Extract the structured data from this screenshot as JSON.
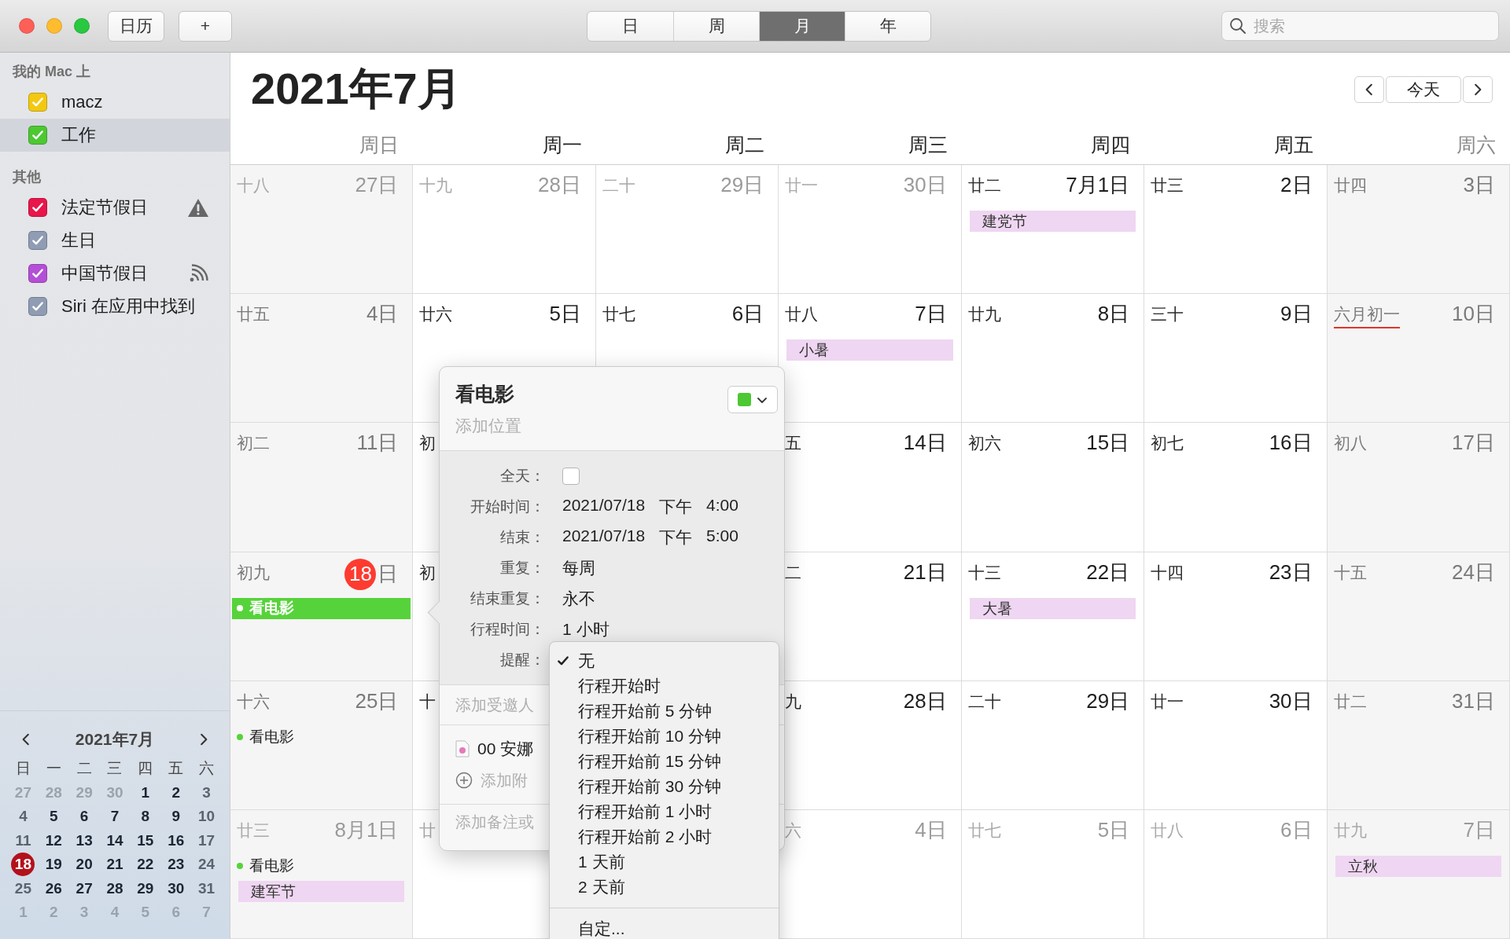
{
  "toolbar": {
    "calendars_button": "日历",
    "add_button": "+",
    "view_tabs": [
      {
        "label": "日",
        "selected": false
      },
      {
        "label": "周",
        "selected": false
      },
      {
        "label": "月",
        "selected": true
      },
      {
        "label": "年",
        "selected": false
      }
    ],
    "search": {
      "placeholder": "搜索"
    }
  },
  "sidebar": {
    "sections": [
      {
        "title": "我的 Mac 上",
        "items": [
          {
            "name": "macz",
            "color": "#f2c811",
            "checked": true,
            "selected": false,
            "kind": "plain"
          },
          {
            "name": "工作",
            "color": "#4cc832",
            "checked": true,
            "selected": true,
            "kind": "plain"
          }
        ]
      },
      {
        "title": "其他",
        "items": [
          {
            "name": "法定节假日",
            "color": "#e8164a",
            "checked": true,
            "selected": false,
            "kind": "warning"
          },
          {
            "name": "生日",
            "color": "#8f9cb3",
            "checked": true,
            "selected": false,
            "kind": "plain"
          },
          {
            "name": "中国节假日",
            "color": "#b44fd6",
            "checked": true,
            "selected": false,
            "kind": "subscribed"
          },
          {
            "name": "Siri 在应用中找到",
            "color": "#8f9cb3",
            "checked": true,
            "selected": false,
            "kind": "plain"
          }
        ]
      }
    ]
  },
  "mini_calendar": {
    "title": "2021年7月",
    "weekdays": [
      "日",
      "一",
      "二",
      "三",
      "四",
      "五",
      "六"
    ],
    "days": [
      {
        "day": "27",
        "other_month": true,
        "today": false
      },
      {
        "day": "28",
        "other_month": true,
        "today": false
      },
      {
        "day": "29",
        "other_month": true,
        "today": false
      },
      {
        "day": "30",
        "other_month": true,
        "today": false
      },
      {
        "day": "1",
        "other_month": false,
        "today": false
      },
      {
        "day": "2",
        "other_month": false,
        "today": false
      },
      {
        "day": "3",
        "other_month": false,
        "today": false
      },
      {
        "day": "4",
        "other_month": false,
        "today": false
      },
      {
        "day": "5",
        "other_month": false,
        "today": false
      },
      {
        "day": "6",
        "other_month": false,
        "today": false
      },
      {
        "day": "7",
        "other_month": false,
        "today": false
      },
      {
        "day": "8",
        "other_month": false,
        "today": false
      },
      {
        "day": "9",
        "other_month": false,
        "today": false
      },
      {
        "day": "10",
        "other_month": false,
        "today": false
      },
      {
        "day": "11",
        "other_month": false,
        "today": false
      },
      {
        "day": "12",
        "other_month": false,
        "today": false
      },
      {
        "day": "13",
        "other_month": false,
        "today": false
      },
      {
        "day": "14",
        "other_month": false,
        "today": false
      },
      {
        "day": "15",
        "other_month": false,
        "today": false
      },
      {
        "day": "16",
        "other_month": false,
        "today": false
      },
      {
        "day": "17",
        "other_month": false,
        "today": false
      },
      {
        "day": "18",
        "other_month": false,
        "today": true
      },
      {
        "day": "19",
        "other_month": false,
        "today": false
      },
      {
        "day": "20",
        "other_month": false,
        "today": false
      },
      {
        "day": "21",
        "other_month": false,
        "today": false
      },
      {
        "day": "22",
        "other_month": false,
        "today": false
      },
      {
        "day": "23",
        "other_month": false,
        "today": false
      },
      {
        "day": "24",
        "other_month": false,
        "today": false
      },
      {
        "day": "25",
        "other_month": false,
        "today": false
      },
      {
        "day": "26",
        "other_month": false,
        "today": false
      },
      {
        "day": "27",
        "other_month": false,
        "today": false
      },
      {
        "day": "28",
        "other_month": false,
        "today": false
      },
      {
        "day": "29",
        "other_month": false,
        "today": false
      },
      {
        "day": "30",
        "other_month": false,
        "today": false
      },
      {
        "day": "31",
        "other_month": false,
        "today": false
      },
      {
        "day": "1",
        "other_month": true,
        "today": false
      },
      {
        "day": "2",
        "other_month": true,
        "today": false
      },
      {
        "day": "3",
        "other_month": true,
        "today": false
      },
      {
        "day": "4",
        "other_month": true,
        "today": false
      },
      {
        "day": "5",
        "other_month": true,
        "today": false
      },
      {
        "day": "6",
        "other_month": true,
        "today": false
      },
      {
        "day": "7",
        "other_month": true,
        "today": false
      }
    ]
  },
  "header": {
    "title": "2021年7月",
    "today_button": "今天"
  },
  "weekdays": [
    "周日",
    "周一",
    "周二",
    "周三",
    "周四",
    "周五",
    "周六"
  ],
  "cells": [
    {
      "lunar": "十八",
      "date": "27日",
      "other_month": true,
      "today": false,
      "lunar_month_start": false
    },
    {
      "lunar": "十九",
      "date": "28日",
      "other_month": true,
      "today": false,
      "lunar_month_start": false
    },
    {
      "lunar": "二十",
      "date": "29日",
      "other_month": true,
      "today": false,
      "lunar_month_start": false
    },
    {
      "lunar": "廿一",
      "date": "30日",
      "other_month": true,
      "today": false,
      "lunar_month_start": false
    },
    {
      "lunar": "廿二",
      "date": "7月1日",
      "other_month": false,
      "today": false,
      "lunar_month_start": false,
      "events": [
        {
          "title": "建党节",
          "kind": "allday",
          "color": "#efd6f2",
          "selected": false
        }
      ]
    },
    {
      "lunar": "廿三",
      "date": "2日",
      "other_month": false,
      "today": false,
      "lunar_month_start": false
    },
    {
      "lunar": "廿四",
      "date": "3日",
      "other_month": false,
      "today": false,
      "lunar_month_start": false
    },
    {
      "lunar": "廿五",
      "date": "4日",
      "other_month": false,
      "today": false,
      "lunar_month_start": false
    },
    {
      "lunar": "廿六",
      "date": "5日",
      "other_month": false,
      "today": false,
      "lunar_month_start": false
    },
    {
      "lunar": "廿七",
      "date": "6日",
      "other_month": false,
      "today": false,
      "lunar_month_start": false
    },
    {
      "lunar": "廿八",
      "date": "7日",
      "other_month": false,
      "today": false,
      "lunar_month_start": false,
      "events": [
        {
          "title": "小暑",
          "kind": "allday",
          "color": "#efd6f2",
          "selected": false
        }
      ]
    },
    {
      "lunar": "廿九",
      "date": "8日",
      "other_month": false,
      "today": false,
      "lunar_month_start": false
    },
    {
      "lunar": "三十",
      "date": "9日",
      "other_month": false,
      "today": false,
      "lunar_month_start": false
    },
    {
      "lunar": "六月初一",
      "date": "10日",
      "other_month": false,
      "today": false,
      "lunar_month_start": true
    },
    {
      "lunar": "初二",
      "date": "11日",
      "other_month": false,
      "today": false,
      "lunar_month_start": false
    },
    {
      "lunar": "初",
      "other_month": false,
      "lunar_month_start": false
    },
    {},
    {
      "lunar": "五",
      "date": "14日",
      "other_month": false,
      "today": false,
      "lunar_month_start": false
    },
    {
      "lunar": "初六",
      "date": "15日",
      "other_month": false,
      "today": false,
      "lunar_month_start": false
    },
    {
      "lunar": "初七",
      "date": "16日",
      "other_month": false,
      "today": false,
      "lunar_month_start": false
    },
    {
      "lunar": "初八",
      "date": "17日",
      "other_month": false,
      "today": false,
      "lunar_month_start": false
    },
    {
      "lunar": "初九",
      "date": "18",
      "date_suffix": "日",
      "other_month": false,
      "today": true,
      "lunar_month_start": false,
      "events": [
        {
          "title": "看电影",
          "kind": "timed",
          "color": "#56d33a",
          "selected": true
        }
      ]
    },
    {
      "lunar": "初",
      "other_month": false,
      "lunar_month_start": false
    },
    {},
    {
      "lunar": "二",
      "date": "21日",
      "other_month": false,
      "today": false,
      "lunar_month_start": false
    },
    {
      "lunar": "十三",
      "date": "22日",
      "other_month": false,
      "today": false,
      "lunar_month_start": false,
      "events": [
        {
          "title": "大暑",
          "kind": "allday",
          "color": "#efd6f2",
          "selected": false
        }
      ]
    },
    {
      "lunar": "十四",
      "date": "23日",
      "other_month": false,
      "today": false,
      "lunar_month_start": false
    },
    {
      "lunar": "十五",
      "date": "24日",
      "other_month": false,
      "today": false,
      "lunar_month_start": false
    },
    {
      "lunar": "十六",
      "date": "25日",
      "other_month": false,
      "today": false,
      "lunar_month_start": false,
      "events": [
        {
          "title": "看电影",
          "kind": "timed",
          "color": "#56d33a",
          "selected": false
        }
      ]
    },
    {
      "lunar": "十",
      "other_month": false,
      "lunar_month_start": false
    },
    {},
    {
      "lunar": "九",
      "date": "28日",
      "other_month": false,
      "today": false,
      "lunar_month_start": false
    },
    {
      "lunar": "二十",
      "date": "29日",
      "other_month": false,
      "today": false,
      "lunar_month_start": false
    },
    {
      "lunar": "廿一",
      "date": "30日",
      "other_month": false,
      "today": false,
      "lunar_month_start": false
    },
    {
      "lunar": "廿二",
      "date": "31日",
      "other_month": false,
      "today": false,
      "lunar_month_start": false
    },
    {
      "lunar": "廿三",
      "date": "8月1日",
      "other_month": true,
      "today": false,
      "lunar_month_start": false,
      "events": [
        {
          "title": "看电影",
          "kind": "timed",
          "color": "#56d33a",
          "selected": false
        },
        {
          "title": "建军节",
          "kind": "allday",
          "color": "#efd6f2",
          "selected": false
        }
      ]
    },
    {
      "lunar": "廿",
      "other_month": true,
      "lunar_month_start": false
    },
    {},
    {
      "lunar": "六",
      "date": "4日",
      "other_month": true,
      "today": false,
      "lunar_month_start": false
    },
    {
      "lunar": "廿七",
      "date": "5日",
      "other_month": true,
      "today": false,
      "lunar_month_start": false
    },
    {
      "lunar": "廿八",
      "date": "6日",
      "other_month": true,
      "today": false,
      "lunar_month_start": false
    },
    {
      "lunar": "廿九",
      "date": "7日",
      "other_month": true,
      "today": false,
      "lunar_month_start": false,
      "events": [
        {
          "title": "立秋",
          "kind": "allday",
          "color": "#efd6f2",
          "selected": false
        }
      ]
    }
  ],
  "popover": {
    "title": "看电影",
    "location_placeholder": "添加位置",
    "color": "#4cc832",
    "fields": [
      {
        "label": "全天：",
        "kind": "checkbox",
        "checked": false
      },
      {
        "label": "开始时间：",
        "kind": "datetime",
        "parts": [
          "2021/07/18",
          "下午",
          "4:00"
        ]
      },
      {
        "label": "结束：",
        "kind": "datetime",
        "parts": [
          "2021/07/18",
          "下午",
          "5:00"
        ]
      },
      {
        "label": "重复：",
        "kind": "text",
        "value": "每周"
      },
      {
        "label": "结束重复：",
        "kind": "text",
        "value": "永不"
      },
      {
        "label": "行程时间：",
        "kind": "text",
        "value": "1 小时"
      },
      {
        "label": "提醒：",
        "kind": "menu"
      }
    ],
    "invitees_placeholder": "添加受邀人",
    "attachments": [
      "00 安娜"
    ],
    "add_attachment": "添加附",
    "notes_placeholder": "添加备注或"
  },
  "reminder_menu": {
    "groups": [
      {
        "items": [
          {
            "label": "无",
            "selected": true
          },
          {
            "label": "行程开始时",
            "selected": false
          },
          {
            "label": "行程开始前 5 分钟",
            "selected": false
          },
          {
            "label": "行程开始前 10 分钟",
            "selected": false
          },
          {
            "label": "行程开始前 15 分钟",
            "selected": false
          },
          {
            "label": "行程开始前 30 分钟",
            "selected": false
          },
          {
            "label": "行程开始前 1 小时",
            "selected": false
          },
          {
            "label": "行程开始前 2 小时",
            "selected": false
          },
          {
            "label": "1 天前",
            "selected": false
          },
          {
            "label": "2 天前",
            "selected": false
          }
        ]
      },
      {
        "items": [
          {
            "label": "自定...",
            "selected": false
          }
        ]
      }
    ]
  }
}
